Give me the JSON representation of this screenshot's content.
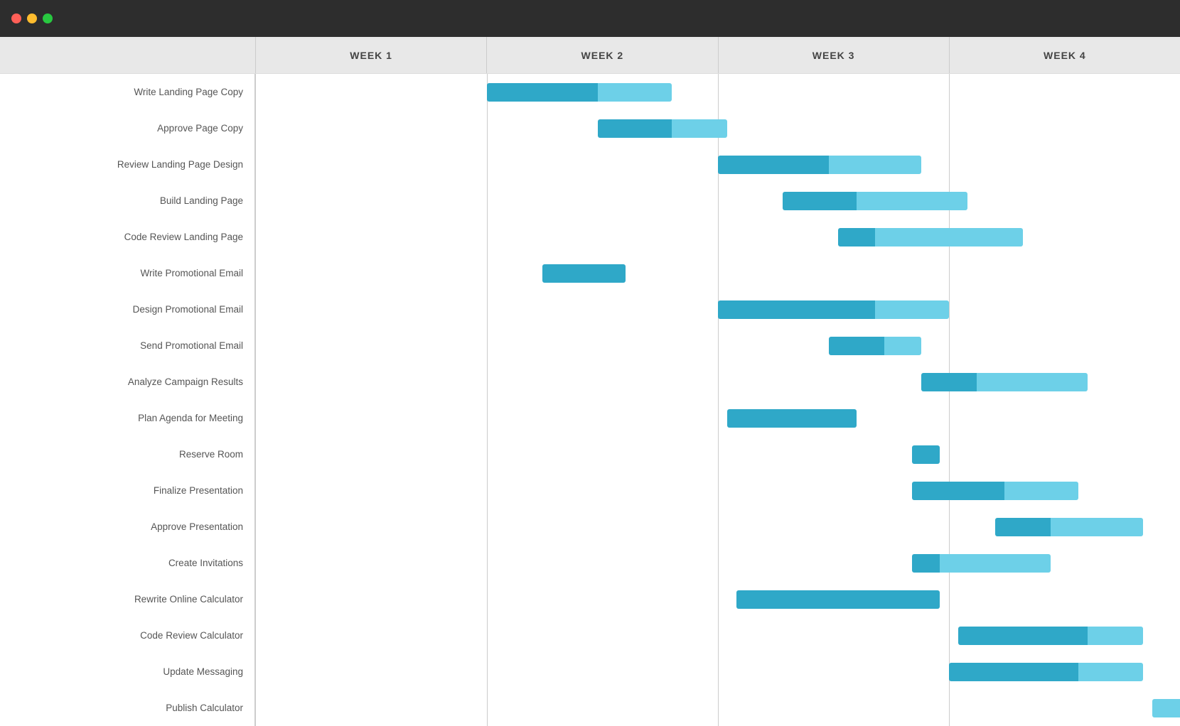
{
  "titlebar": {
    "dots": [
      "red",
      "yellow",
      "green"
    ]
  },
  "weeks": [
    "WEEK 1",
    "WEEK 2",
    "WEEK 3",
    "WEEK 4"
  ],
  "tasks": [
    {
      "label": "Write Landing Page Copy",
      "start": 0.25,
      "done": 0.12,
      "rem": 0.08
    },
    {
      "label": "Approve Page Copy",
      "start": 0.37,
      "done": 0.08,
      "rem": 0.06
    },
    {
      "label": "Review Landing Page Design",
      "start": 0.5,
      "done": 0.12,
      "rem": 0.1
    },
    {
      "label": "Build Landing Page",
      "start": 0.57,
      "done": 0.08,
      "rem": 0.12
    },
    {
      "label": "Code Review Landing Page",
      "start": 0.63,
      "done": 0.04,
      "rem": 0.16
    },
    {
      "label": "Write Promotional Email",
      "start": 0.31,
      "done": 0.09,
      "rem": 0.0
    },
    {
      "label": "Design Promotional Email",
      "start": 0.5,
      "done": 0.17,
      "rem": 0.08
    },
    {
      "label": "Send Promotional Email",
      "start": 0.62,
      "done": 0.06,
      "rem": 0.04
    },
    {
      "label": "Analyze Campaign Results",
      "start": 0.72,
      "done": 0.06,
      "rem": 0.12
    },
    {
      "label": "Plan Agenda for Meeting",
      "start": 0.51,
      "done": 0.14,
      "rem": 0.0
    },
    {
      "label": "Reserve Room",
      "start": 0.71,
      "done": 0.03,
      "rem": 0.0
    },
    {
      "label": "Finalize Presentation",
      "start": 0.71,
      "done": 0.1,
      "rem": 0.08
    },
    {
      "label": "Approve Presentation",
      "start": 0.8,
      "done": 0.06,
      "rem": 0.1
    },
    {
      "label": "Create Invitations",
      "start": 0.71,
      "done": 0.03,
      "rem": 0.12
    },
    {
      "label": "Rewrite Online Calculator",
      "start": 0.52,
      "done": 0.22,
      "rem": 0.0
    },
    {
      "label": "Code Review Calculator",
      "start": 0.76,
      "done": 0.14,
      "rem": 0.06
    },
    {
      "label": "Update Messaging",
      "start": 0.75,
      "done": 0.14,
      "rem": 0.07
    },
    {
      "label": "Publish Calculator",
      "start": 0.97,
      "done": 0.0,
      "rem": 0.04
    }
  ]
}
